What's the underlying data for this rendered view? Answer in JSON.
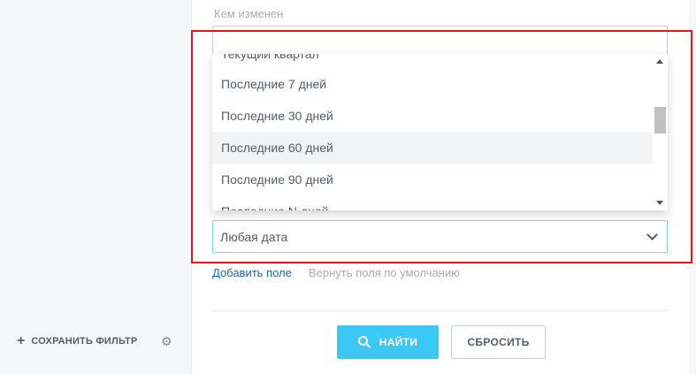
{
  "sidebar": {
    "save_filter_label": "СОХРАНИТЬ ФИЛЬТР"
  },
  "filter": {
    "changed_by_label": "Кем изменен",
    "date_field_value": "Любая дата",
    "dropdown_options": [
      "Текущий квартал",
      "Последние 7 дней",
      "Последние 30 дней",
      "Последние 60 дней",
      "Последние 90 дней",
      "Последние N дней"
    ],
    "hovered_option_index": 3,
    "add_field_link": "Добавить поле",
    "restore_fields_link": "Вернуть поля по умолчанию"
  },
  "actions": {
    "search_label": "НАЙТИ",
    "reset_label": "СБРОСИТЬ"
  },
  "colors": {
    "accent": "#3bc8f5",
    "link": "#2067b0",
    "highlight_frame": "#e8141b"
  },
  "icons": {
    "save_filter": "plus-icon",
    "settings": "gear-icon",
    "search": "search-icon",
    "select": "chevron-down-icon"
  }
}
